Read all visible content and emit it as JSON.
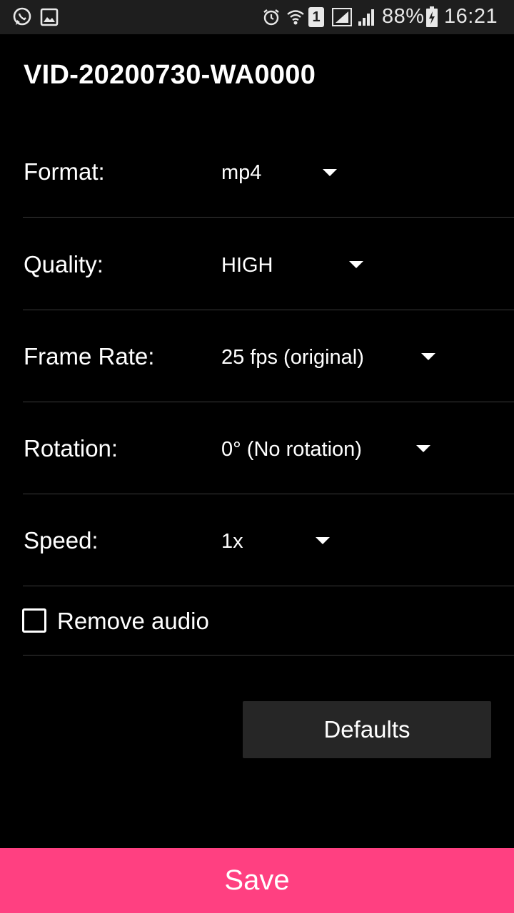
{
  "status_bar": {
    "battery": "88%",
    "time": "16:21",
    "sim_badge": "1",
    "icons": [
      "whatsapp-icon",
      "gallery-icon",
      "alarm-icon",
      "wifi-icon",
      "sim-icon",
      "signal-icon",
      "signal-icon",
      "battery-charging-icon"
    ]
  },
  "dialog": {
    "title": "VID-20200730-WA0000",
    "rows": [
      {
        "label": "Format:",
        "value": "mp4"
      },
      {
        "label": "Quality:",
        "value": "HIGH"
      },
      {
        "label": "Frame Rate:",
        "value": "25 fps (original)"
      },
      {
        "label": "Rotation:",
        "value": "0° (No rotation)"
      },
      {
        "label": "Speed:",
        "value": "1x"
      }
    ],
    "remove_audio": {
      "label": "Remove audio",
      "checked": false
    },
    "defaults_label": "Defaults"
  },
  "save_label": "Save",
  "colors": {
    "accent": "#ff4081",
    "background": "#000000",
    "button_bg": "#262626"
  }
}
